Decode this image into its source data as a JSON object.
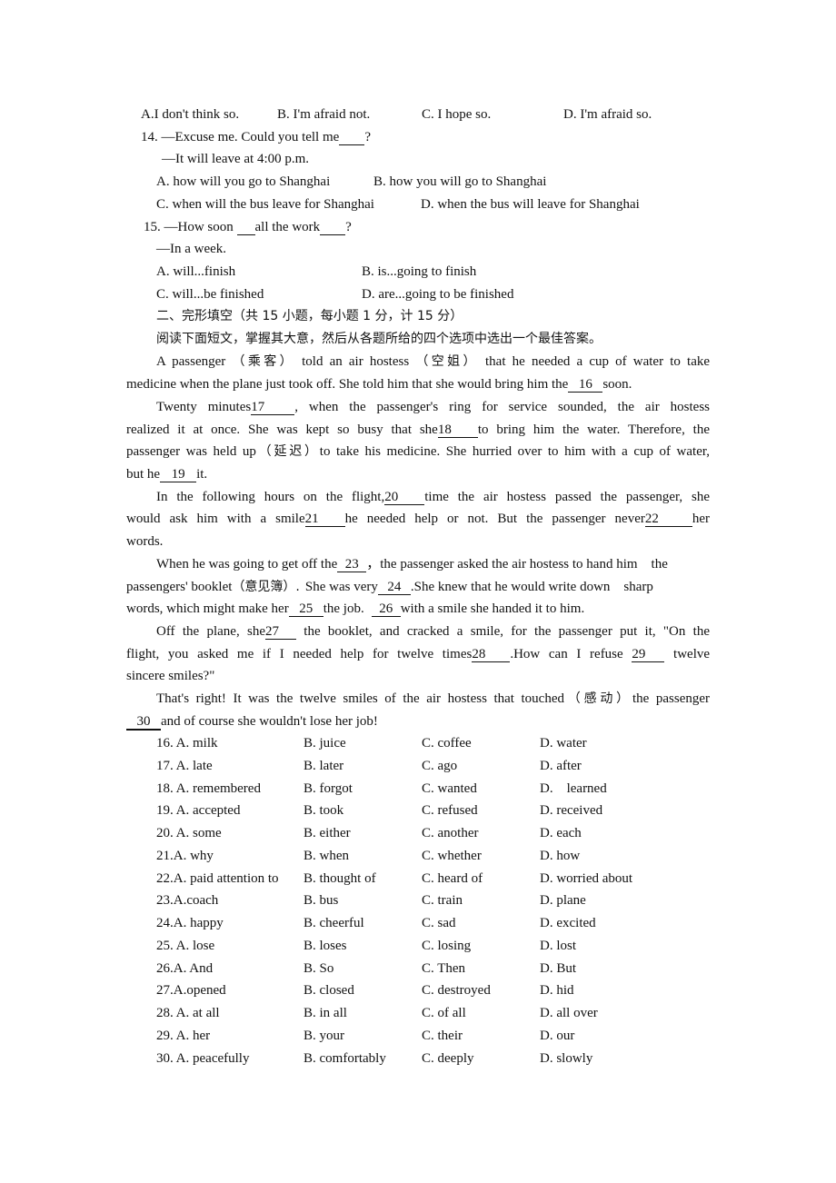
{
  "q13": {
    "options": [
      "A.I don't think so.",
      "B. I'm afraid not.",
      "C. I hope so.",
      "D. I'm afraid so."
    ]
  },
  "q14": {
    "stem_pre": "14. —Excuse me. Could you tell me",
    "stem_post": "?",
    "reply": "—It will leave at 4:00 p.m.",
    "options": [
      "A. how will you go to Shanghai",
      "B. how you will go to Shanghai",
      "C. when will the bus leave for Shanghai",
      "D. when the bus will leave for Shanghai"
    ]
  },
  "q15": {
    "stem_a": "15. —How soon ",
    "stem_b": "all the work",
    "stem_c": "?",
    "reply": "—In a week.",
    "options": [
      "A. will...finish",
      "B. is...going to finish",
      "C. will...be finished",
      "D. are...going to be finished"
    ]
  },
  "section2": {
    "heading": "二、完形填空（共 15 小题，每小题 1 分，计 15 分）",
    "instruction": "阅读下面短文，掌握其大意，然后从各题所给的四个选项中选出一个最佳答案。"
  },
  "passage": {
    "p1_l1": [
      "A passenger",
      "（乘客）",
      "told an air hostess",
      "（空姐）",
      "that he needed a cup of water to take"
    ],
    "p1_l2": [
      "medicine when the plane just took off. She told him that she would bring him the",
      "16",
      "soon."
    ],
    "p2_l1": [
      "Twenty minutes",
      "17",
      ", when the passenger's ring for service sounded, the air hostess"
    ],
    "p2_l2": [
      "realized it at once. She was kept so busy that she",
      "18",
      "to bring him the water. Therefore, the"
    ],
    "p2_l3": [
      "passenger was held up",
      "（延迟）",
      "to take his medicine. She hurried over to him with a cup of water,"
    ],
    "p2_l4": [
      "but he",
      "19",
      "it."
    ],
    "p3_l1": [
      "In the following hours on the flight,",
      "20",
      "time the air hostess passed the passenger, she"
    ],
    "p3_l2": [
      "would ask him with a smile",
      "21",
      "he needed help or not. But the passenger never",
      "22",
      "her"
    ],
    "p3_l3": [
      "words."
    ],
    "p4_l1": [
      "When he was going to get off the",
      "23",
      "，the passenger asked the air hostess to hand him    the"
    ],
    "p4_l2": [
      "passengers' booklet",
      "（意见簿）.",
      "She was very",
      "24",
      ".She knew that he would write down    sharp"
    ],
    "p4_l3": [
      "words, which might make her",
      "25",
      "the job.",
      "26",
      "with a smile she handed it to him."
    ],
    "p5_l1": [
      "Off the plane, she",
      "27",
      " the booklet, and cracked a smile, for the passenger put it, \"On the"
    ],
    "p5_l2": [
      "flight, you asked me if I needed help for twelve times",
      "28",
      ".How can I refuse",
      "29",
      "twelve"
    ],
    "p5_l3": [
      "sincere smiles?\""
    ],
    "p6_l1": [
      "That's right! It was the twelve smiles of the air hostess that touched",
      "（感动）",
      "the passenger"
    ],
    "p6_l2": [
      "30",
      "and of course she wouldn't lose her job!"
    ]
  },
  "choices": [
    [
      "16. A. milk",
      "B. juice",
      "C. coffee",
      "D. water"
    ],
    [
      "17. A. late",
      "B. later",
      "C. ago",
      "D. after"
    ],
    [
      "18. A. remembered",
      "B. forgot",
      "C. wanted",
      "D.    learned"
    ],
    [
      "19. A. accepted",
      "B. took",
      "C. refused",
      "D. received"
    ],
    [
      "20. A. some",
      "B. either",
      "C. another",
      "D. each"
    ],
    [
      "21.A. why",
      "B. when",
      "C. whether",
      "D. how"
    ],
    [
      "22.A. paid attention to",
      "B. thought of",
      "C. heard of",
      "D. worried about"
    ],
    [
      "23.A.coach",
      "B. bus",
      "C. train",
      "D. plane"
    ],
    [
      "24.A. happy",
      "B. cheerful",
      "C. sad",
      "D. excited"
    ],
    [
      "25. A. lose",
      "B. loses",
      "C. losing",
      "D. lost"
    ],
    [
      "26.A. And",
      "B. So",
      "C. Then",
      "D. But"
    ],
    [
      "27.A.opened",
      "B. closed",
      "C. destroyed",
      "D. hid"
    ],
    [
      "28. A. at all",
      "B. in all",
      "C. of all",
      "D. all over"
    ],
    [
      "29. A. her",
      "B. your",
      "C. their",
      "D. our"
    ],
    [
      "30. A. peacefully",
      "B. comfortably",
      "C. deeply",
      "D. slowly"
    ]
  ]
}
